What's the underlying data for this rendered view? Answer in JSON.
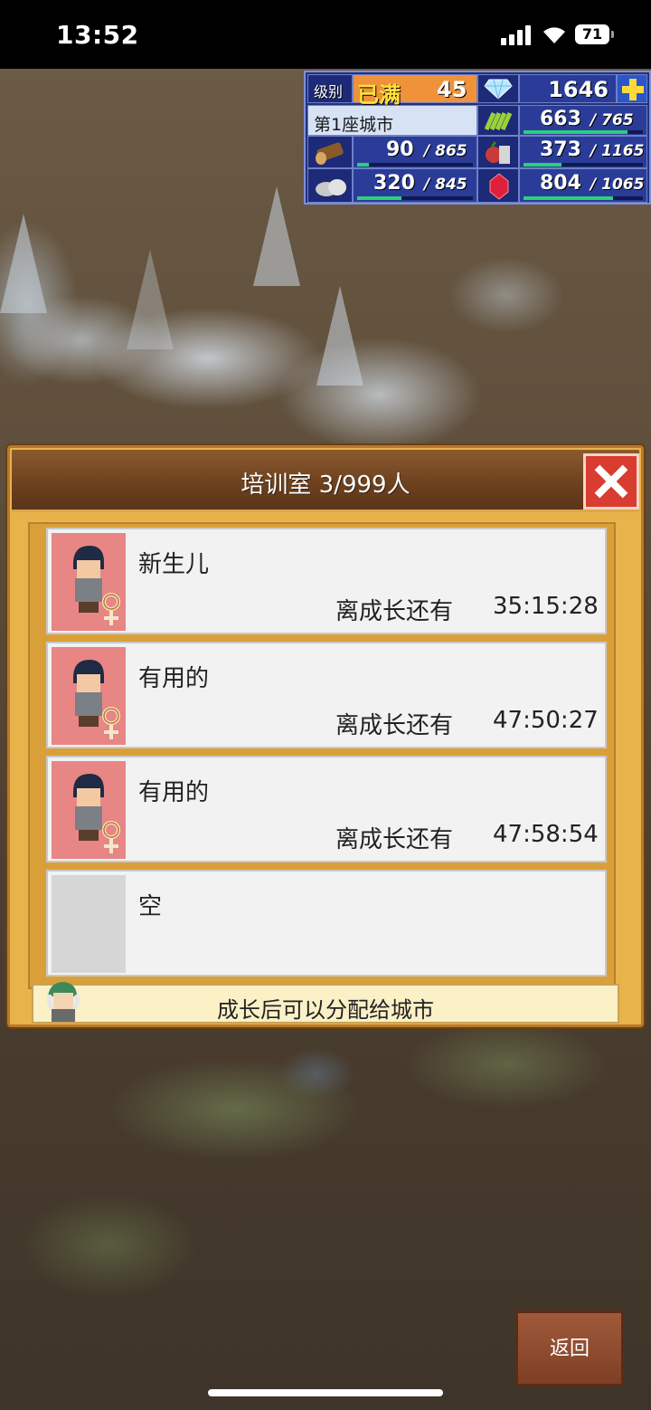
{
  "status_bar": {
    "time": "13:52",
    "battery": "71"
  },
  "hud": {
    "level_label": "级别",
    "level_status": "已满",
    "level_value": "45",
    "gems": "1646",
    "city_name": "第1座城市",
    "resources": [
      {
        "icon": "crop-icon",
        "value": "663",
        "max": "765",
        "fill": 0.87
      },
      {
        "icon": "wood-icon",
        "value": "90",
        "max": "865",
        "fill": 0.1
      },
      {
        "icon": "food-icon",
        "value": "373",
        "max": "1165",
        "fill": 0.32
      },
      {
        "icon": "stone-icon",
        "value": "320",
        "max": "845",
        "fill": 0.38
      },
      {
        "icon": "ruby-icon",
        "value": "804",
        "max": "1065",
        "fill": 0.75
      }
    ]
  },
  "dialog": {
    "title": "培训室 3/999人",
    "rows": [
      {
        "name": "新生儿",
        "label": "离成长还有",
        "time": "35:15:28"
      },
      {
        "name": "有用的",
        "label": "离成长还有",
        "time": "47:50:27"
      },
      {
        "name": "有用的",
        "label": "离成长还有",
        "time": "47:58:54"
      },
      {
        "name": "空",
        "label": "",
        "time": ""
      }
    ],
    "hint": "成长后可以分配给城市"
  },
  "back_button": "返回",
  "colors": {
    "hud_bg": "#23307a",
    "bar_fill": "#2ad07a",
    "dialog_bg": "#e8b34a",
    "close_red": "#d93c30",
    "portrait_pink": "#e88585"
  }
}
